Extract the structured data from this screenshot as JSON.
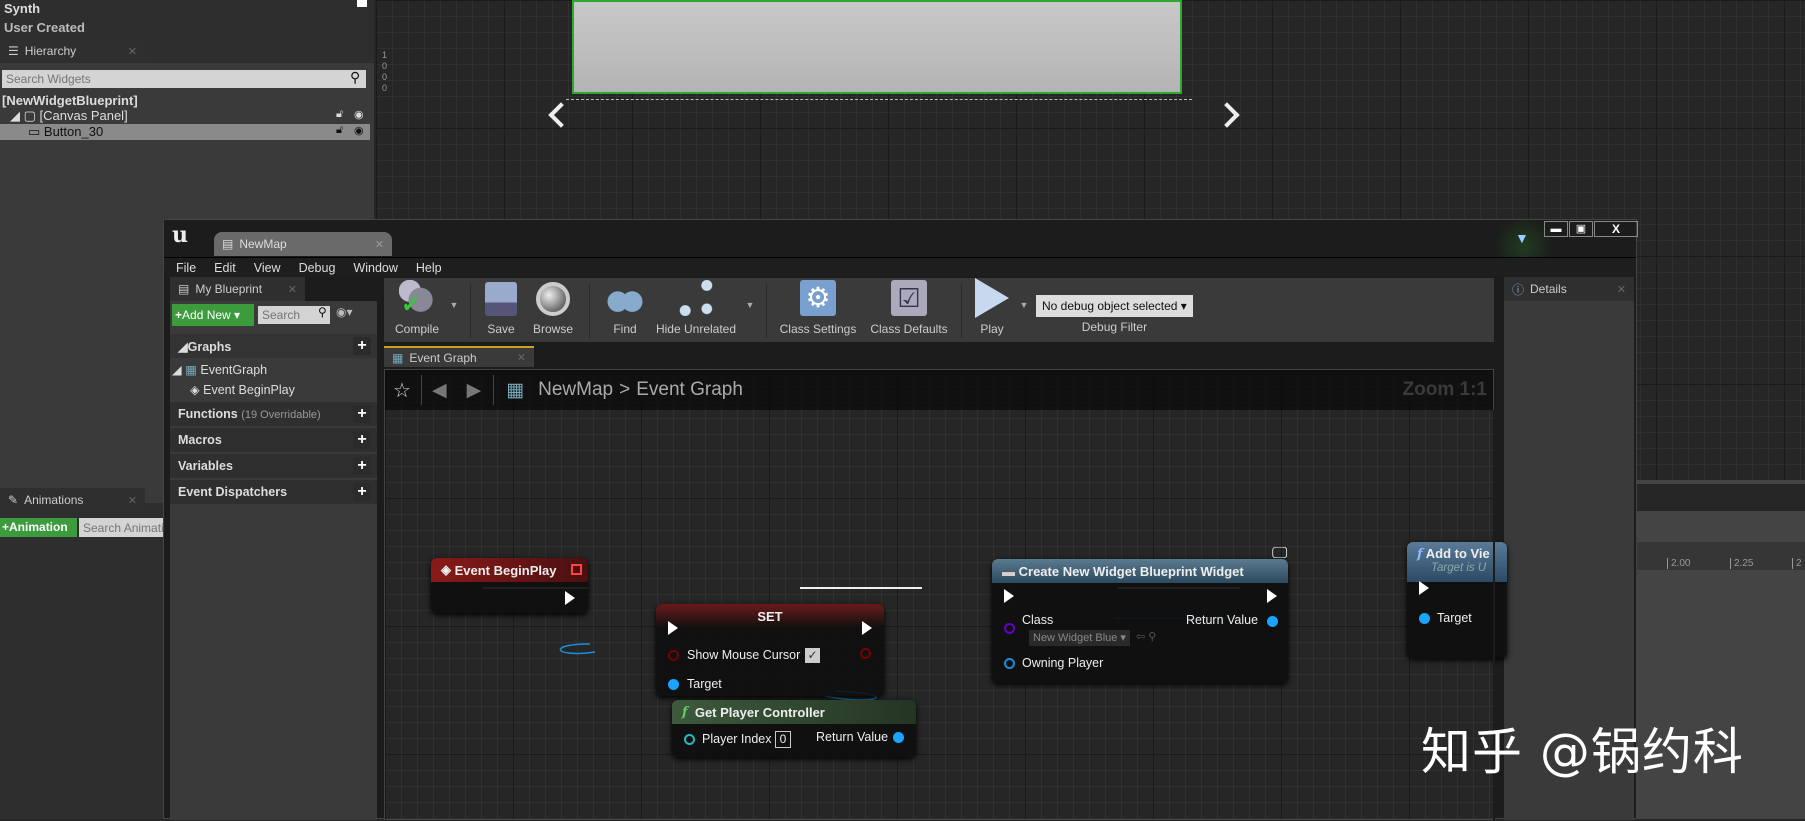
{
  "designer": {
    "palette_items": [
      "Synth",
      "User Created"
    ],
    "hierarchy_tab": "Hierarchy",
    "search_placeholder": "Search Widgets",
    "tree": [
      "[NewWidgetBlueprint]",
      "[Canvas Panel]",
      "Button_30"
    ],
    "ruler": "1000",
    "animations_tab": "Animations",
    "add_animation": "Animation",
    "search_anim_placeholder": "Search Animations",
    "timeline_ticks": [
      "2.00",
      "2.25",
      "2"
    ]
  },
  "window": {
    "tab": "NewMap",
    "menu": [
      "File",
      "Edit",
      "View",
      "Debug",
      "Window",
      "Help"
    ]
  },
  "my_blueprint": {
    "tab": "My Blueprint",
    "add_new": "Add New",
    "search_placeholder": "Search",
    "graphs": "Graphs",
    "event_graph": "EventGraph",
    "event_beginplay": "Event BeginPlay",
    "functions": "Functions",
    "functions_note": "(19 Overridable)",
    "macros": "Macros",
    "variables": "Variables",
    "dispatchers": "Event Dispatchers"
  },
  "toolbar": {
    "compile": "Compile",
    "save": "Save",
    "browse": "Browse",
    "find": "Find",
    "hide_unrelated": "Hide Unrelated",
    "class_settings": "Class Settings",
    "class_defaults": "Class Defaults",
    "play": "Play",
    "debug_select": "No debug object selected",
    "debug_filter": "Debug Filter"
  },
  "details": {
    "tab": "Details"
  },
  "graph": {
    "tab": "Event Graph",
    "crumb_root": "NewMap",
    "crumb_sep": ">",
    "crumb_leaf": "Event Graph",
    "zoom": "Zoom 1:1"
  },
  "nodes": {
    "begin": {
      "title": "Event BeginPlay"
    },
    "set": {
      "title": "SET",
      "show_cursor": "Show Mouse Cursor",
      "target": "Target"
    },
    "gpc": {
      "title": "Get Player Controller",
      "player_index": "Player Index",
      "index_value": "0",
      "return": "Return Value"
    },
    "create": {
      "title": "Create New Widget Blueprint Widget",
      "class": "Class",
      "class_value": "New Widget Blue",
      "owning": "Owning Player",
      "return": "Return Value"
    },
    "add": {
      "title": "Add to Vie",
      "subtitle": "Target is U",
      "target": "Target"
    }
  },
  "watermark": "知乎 @锅约科",
  "colors": {
    "event": "#8a1a1a",
    "set": "#6a1a1a",
    "func_green": "#3d5a3d",
    "func_blue": "#3a5a78",
    "add_btn": "#3c9b3c",
    "pin_blue": "#1aa3ff"
  }
}
